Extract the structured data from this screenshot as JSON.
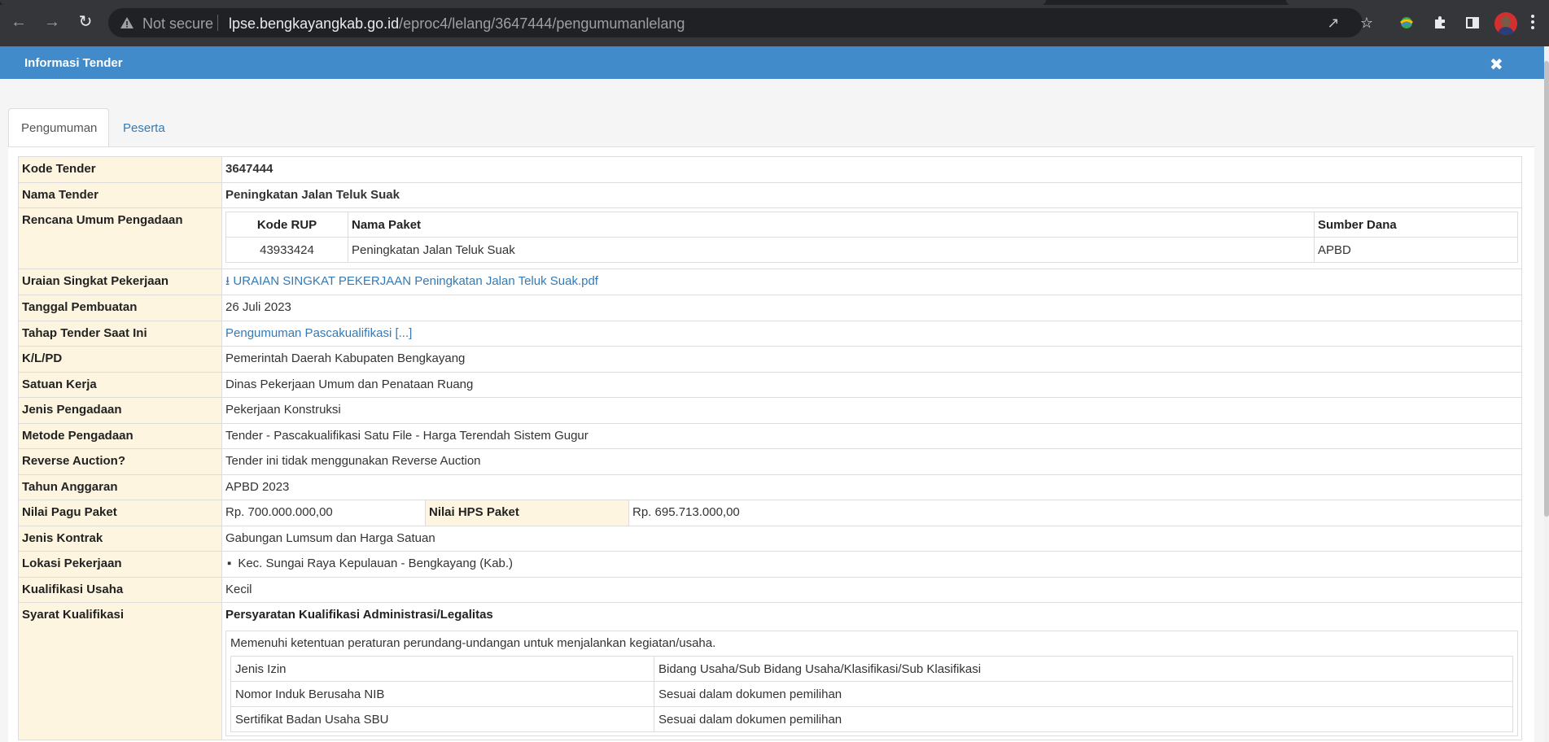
{
  "browser": {
    "security_label": "Not secure",
    "url_host": "lpse.bengkayangkab.go.id",
    "url_path": "/eproc4/lelang/3647444/pengumumanlelang"
  },
  "modal": {
    "title": "Informasi Tender"
  },
  "tabs": [
    "Pengumuman",
    "Peserta"
  ],
  "tender": {
    "rows": {
      "kode_tender": {
        "label": "Kode Tender",
        "value": "3647444"
      },
      "nama_tender": {
        "label": "Nama Tender",
        "value": "Peningkatan Jalan Teluk Suak"
      },
      "rup": {
        "label": "Rencana Umum Pengadaan",
        "headers": [
          "Kode RUP",
          "Nama Paket",
          "Sumber Dana"
        ],
        "row": [
          "43933424",
          "Peningkatan Jalan Teluk Suak",
          "APBD"
        ]
      },
      "uraian": {
        "label": "Uraian Singkat Pekerjaan",
        "value": "URAIAN SINGKAT PEKERJAAN Peningkatan Jalan Teluk Suak.pdf"
      },
      "tanggal": {
        "label": "Tanggal Pembuatan",
        "value": "26 Juli 2023"
      },
      "tahap": {
        "label": "Tahap Tender Saat Ini",
        "value": "Pengumuman Pascakualifikasi [...]"
      },
      "klpd": {
        "label": "K/L/PD",
        "value": "Pemerintah Daerah Kabupaten Bengkayang"
      },
      "satker": {
        "label": "Satuan Kerja",
        "value": "Dinas Pekerjaan Umum dan Penataan Ruang"
      },
      "jenis_pengadaan": {
        "label": "Jenis Pengadaan",
        "value": "Pekerjaan Konstruksi"
      },
      "metode": {
        "label": "Metode Pengadaan",
        "value": "Tender - Pascakualifikasi Satu File - Harga Terendah Sistem Gugur"
      },
      "reverse": {
        "label": "Reverse Auction?",
        "value": "Tender ini tidak menggunakan Reverse Auction"
      },
      "tahun": {
        "label": "Tahun Anggaran",
        "value": "APBD 2023"
      },
      "pagu": {
        "label": "Nilai Pagu Paket",
        "value": "Rp. 700.000.000,00",
        "hps_label": "Nilai HPS Paket",
        "hps_value": "Rp. 695.713.000,00"
      },
      "kontrak": {
        "label": "Jenis Kontrak",
        "value": "Gabungan Lumsum dan Harga Satuan"
      },
      "lokasi": {
        "label": "Lokasi Pekerjaan",
        "value": "Kec. Sungai Raya Kepulauan - Bengkayang (Kab.)"
      },
      "kualifikasi": {
        "label": "Kualifikasi Usaha",
        "value": "Kecil"
      },
      "syarat": {
        "label": "Syarat Kualifikasi",
        "heading": "Persyaratan Kualifikasi Administrasi/Legalitas",
        "desc": "Memenuhi ketentuan peraturan perundang-undangan untuk menjalankan kegiatan/usaha.",
        "izin": [
          [
            "Jenis Izin",
            "Bidang Usaha/Sub Bidang Usaha/Klasifikasi/Sub Klasifikasi"
          ],
          [
            "Nomor Induk Berusaha NIB",
            "Sesuai dalam dokumen pemilihan"
          ],
          [
            "Sertifikat Badan Usaha SBU",
            "Sesuai dalam dokumen pemilihan"
          ]
        ]
      }
    }
  }
}
